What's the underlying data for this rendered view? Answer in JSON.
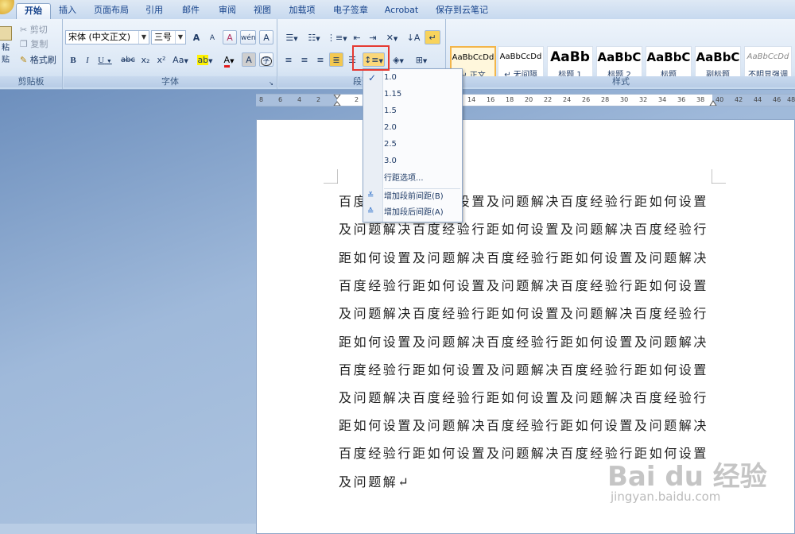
{
  "tabs": [
    "开始",
    "插入",
    "页面布局",
    "引用",
    "邮件",
    "审阅",
    "视图",
    "加载项",
    "电子签章",
    "Acrobat",
    "保存到云笔记"
  ],
  "clipboard": {
    "paste": "粘贴",
    "cut": "剪切",
    "copy": "复制",
    "format_painter": "格式刷",
    "group_label": "剪贴板"
  },
  "font": {
    "name": "宋体 (中文正文)",
    "size": "三号",
    "group_label": "字体",
    "bold": "B",
    "italic": "I",
    "underline": "U",
    "strike": "abc",
    "sub": "x₂",
    "sup": "x²",
    "case": "Aa",
    "highlight": "ab",
    "color": "A",
    "grow": "A",
    "shrink": "A",
    "clear": "A",
    "phonetic": "wén",
    "border": "A",
    "circle": "字"
  },
  "paragraph": {
    "group_label": "段落"
  },
  "styles": {
    "group_label": "样式",
    "items": [
      {
        "sample": "AaBbCcDd",
        "name": "↵ 正文"
      },
      {
        "sample": "AaBbCcDd",
        "name": "↵ 无间隔"
      },
      {
        "sample": "AaBb",
        "name": "标题 1"
      },
      {
        "sample": "AaBbC",
        "name": "标题 2"
      },
      {
        "sample": "AaBbC",
        "name": "标题"
      },
      {
        "sample": "AaBbC",
        "name": "副标题"
      },
      {
        "sample": "AaBbCcDd",
        "name": "不明显强调"
      }
    ]
  },
  "ruler_numbers": [
    "8",
    "6",
    "4",
    "2",
    "2",
    "14",
    "16",
    "18",
    "20",
    "22",
    "24",
    "26",
    "28",
    "30",
    "32",
    "34",
    "36",
    "38",
    "40",
    "42",
    "44",
    "46",
    "48"
  ],
  "line_spacing_menu": {
    "options": [
      "1.0",
      "1.15",
      "1.5",
      "2.0",
      "2.5",
      "3.0"
    ],
    "selected": "1.0",
    "more": "行距选项...",
    "add_before": "增加段前间距(B)",
    "add_after": "增加段后间距(A)"
  },
  "document": {
    "lines": [
      "百度经验行距如何设置及问题解决百度经验行距如何设置",
      "及问题解决百度经验行距如何设置及问题解决百度经验行",
      "距如何设置及问题解决百度经验行距如何设置及问题解决",
      "百度经验行距如何设置及问题解决百度经验行距如何设置",
      "及问题解决百度经验行距如何设置及问题解决百度经验行",
      "距如何设置及问题解决百度经验行距如何设置及问题解决",
      "百度经验行距如何设置及问题解决百度经验行距如何设置",
      "及问题解决百度经验行距如何设置及问题解决百度经验行",
      "距如何设置及问题解决百度经验行距如何设置及问题解决",
      "百度经验行距如何设置及问题解决百度经验行距如何设置",
      "及问题解↵"
    ]
  },
  "watermark": {
    "brand": "Bai du 经验",
    "url": "jingyan.baidu.com"
  },
  "colors": {
    "highlight_box": "#e53a32",
    "accent": "#15428b"
  }
}
